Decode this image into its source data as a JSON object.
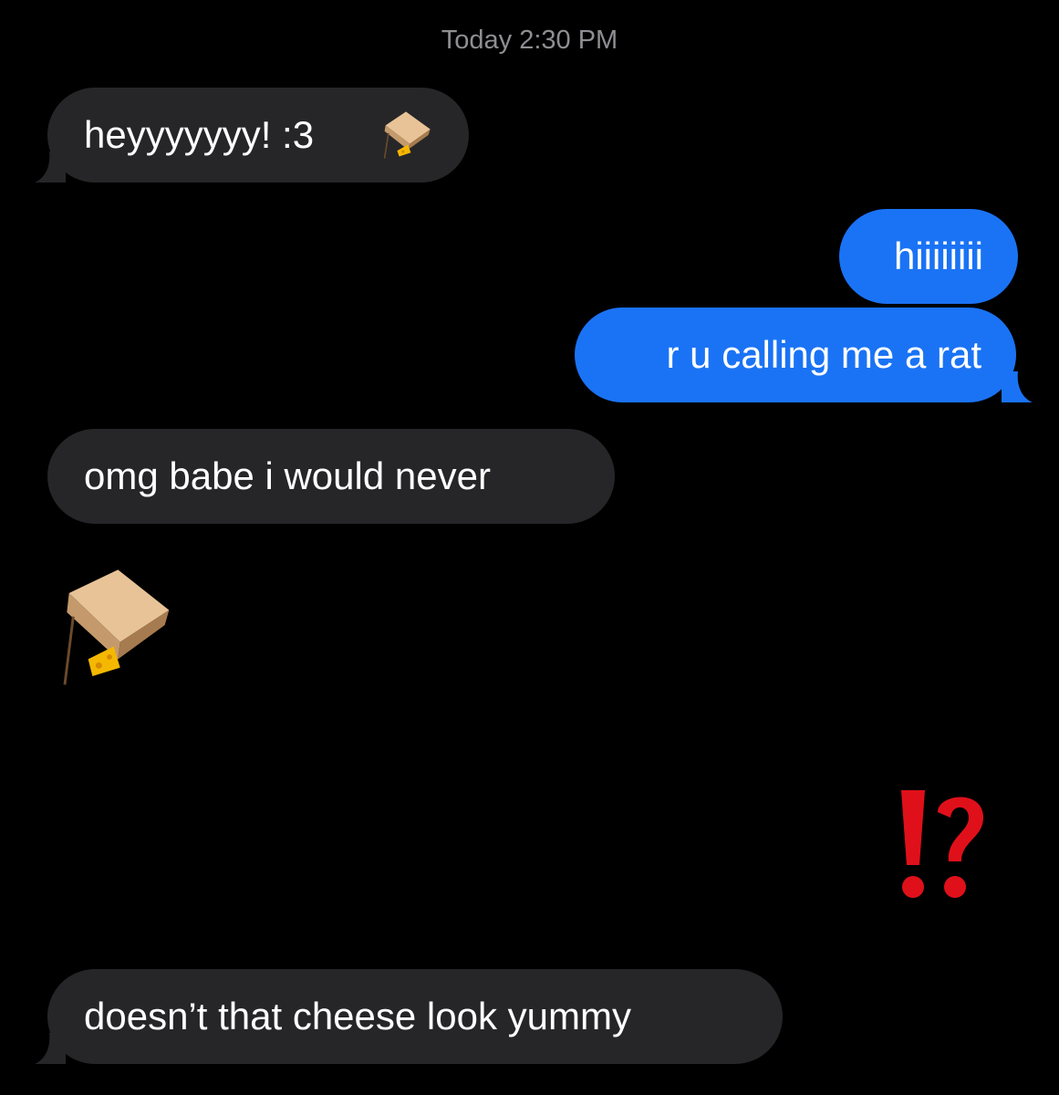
{
  "conversation": {
    "timestamp": "Today 2:30 PM",
    "messages": [
      {
        "direction": "received",
        "text": "heyyyyyyy! :3",
        "emoji": "mouse-trap-icon"
      },
      {
        "direction": "sent",
        "text": "hiiiiiiii"
      },
      {
        "direction": "sent",
        "text": "r u calling me a rat"
      },
      {
        "direction": "received",
        "text": "omg babe i would never"
      },
      {
        "direction": "received",
        "emoji": "mouse-trap-icon"
      },
      {
        "direction": "sent",
        "emoji": "interrobang-icon"
      },
      {
        "direction": "received",
        "text": "doesn’t that cheese look yummy"
      }
    ]
  },
  "colors": {
    "background": "#000000",
    "received_bubble": "#262628",
    "sent_bubble": "#1a73f5",
    "timestamp": "#8e8e93",
    "interrobang": "#e0101a"
  }
}
